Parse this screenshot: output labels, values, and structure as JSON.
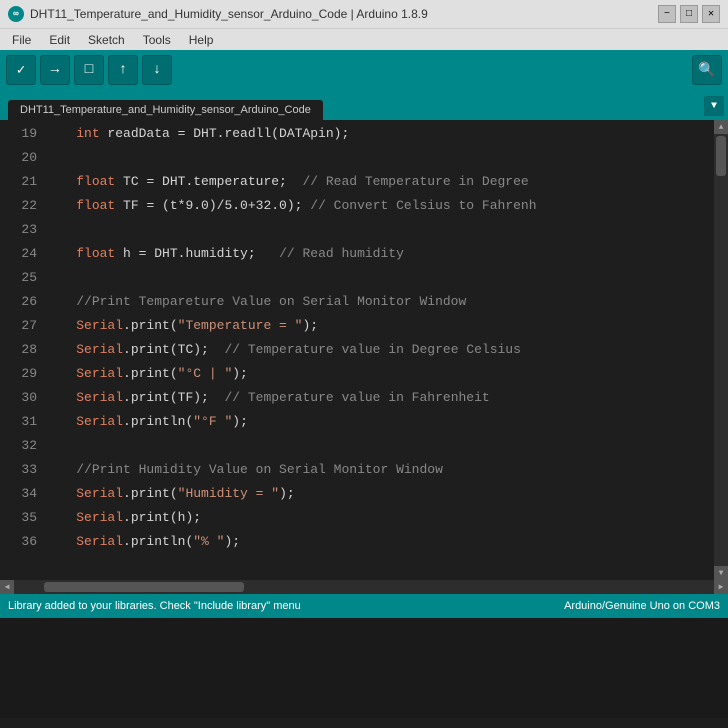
{
  "titleBar": {
    "title": "DHT11_Temperature_and_Humidity_sensor_Arduino_Code | Arduino 1.8.9",
    "minimize": "−",
    "maximize": "□",
    "close": "✕"
  },
  "menuBar": {
    "items": [
      "File",
      "Edit",
      "Sketch",
      "Tools",
      "Help"
    ]
  },
  "toolbar": {
    "buttons": [
      "✓",
      "→",
      "□",
      "↑",
      "↓"
    ]
  },
  "tab": {
    "label": "DHT11_Temperature_and_Humidity_sensor_Arduino_Code",
    "arrow": "▼"
  },
  "statusBar": {
    "text": "Library added to your libraries. Check \"Include library\" menu",
    "right": "Arduino/Genuine Uno on COM3"
  },
  "code": {
    "lines": [
      {
        "num": 19,
        "content": "    int readData = DHT.readll(DATApin);"
      },
      {
        "num": 20,
        "content": ""
      },
      {
        "num": 21,
        "content": "    float TC = DHT.temperature;  // Read Temperature in Degree"
      },
      {
        "num": 22,
        "content": "    float TF = (t*9.0)/5.0+32.0); // Convert Celsius to Fahrenh"
      },
      {
        "num": 23,
        "content": ""
      },
      {
        "num": 24,
        "content": "    float h = DHT.humidity;   // Read humidity"
      },
      {
        "num": 25,
        "content": ""
      },
      {
        "num": 26,
        "content": "    //Print Tempareture Value on Serial Monitor Window"
      },
      {
        "num": 27,
        "content": "    Serial.print(\"Temperature = \");"
      },
      {
        "num": 28,
        "content": "    Serial.print(TC);  // Temperature value in Degree Celsius"
      },
      {
        "num": 29,
        "content": "    Serial.print(\"°C | \");"
      },
      {
        "num": 30,
        "content": "    Serial.print(TF);  // Temperature value in Fahrenheit"
      },
      {
        "num": 31,
        "content": "    Serial.println(\"°F \");"
      },
      {
        "num": 32,
        "content": ""
      },
      {
        "num": 33,
        "content": "    //Print Humidity Value on Serial Monitor Window"
      },
      {
        "num": 34,
        "content": "    Serial.print(\"Humidity = \");"
      },
      {
        "num": 35,
        "content": "    Serial.print(h);"
      },
      {
        "num": 36,
        "content": "    Serial.println(\"% \");"
      }
    ]
  }
}
